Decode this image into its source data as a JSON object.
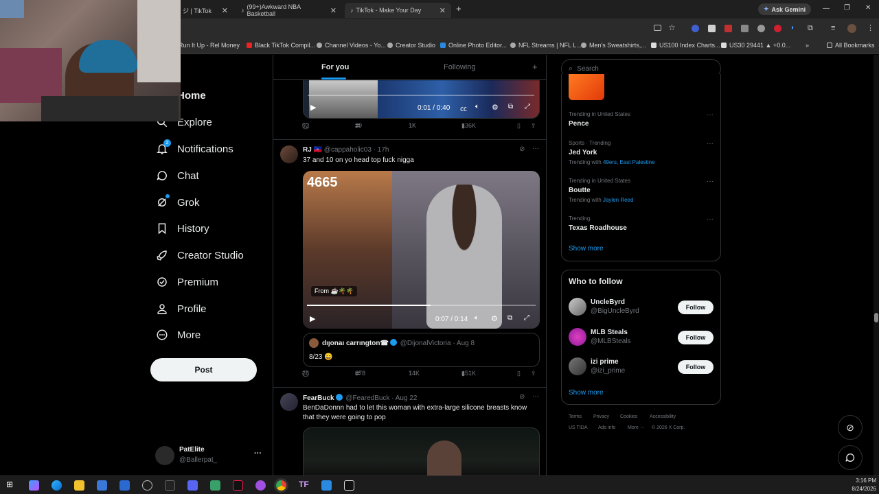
{
  "browser": {
    "tabs": [
      {
        "title": "ジ | TikTok"
      },
      {
        "title": "(99+)Awkward NBA Basketball"
      },
      {
        "title": "TikTok - Make Your Day"
      }
    ],
    "new_tab": "+",
    "ask_gemini": "Ask Gemini",
    "bookmarks": [
      "Run It Up - Rel Money",
      "Black TikTok Compil...",
      "Channel Videos - Yo...",
      "Creator Studio",
      "Online Photo Editor...",
      "NFL Streams | NFL L...",
      "Men's Sweatshirts,...",
      "US100 Index Charts...",
      "US30 29441 ▲ +0.0...",
      "All Bookmarks"
    ]
  },
  "nav": {
    "items": [
      {
        "label": "Home",
        "icon": "home-icon"
      },
      {
        "label": "Explore",
        "icon": "search-icon"
      },
      {
        "label": "Notifications",
        "icon": "bell-icon",
        "badge": "2"
      },
      {
        "label": "Chat",
        "icon": "chat-icon"
      },
      {
        "label": "Grok",
        "icon": "grok-icon"
      },
      {
        "label": "History",
        "icon": "bookmark-icon"
      },
      {
        "label": "Creator Studio",
        "icon": "rocket-icon"
      },
      {
        "label": "Premium",
        "icon": "verified-icon"
      },
      {
        "label": "Profile",
        "icon": "person-icon"
      },
      {
        "label": "More",
        "icon": "more-circle-icon"
      }
    ],
    "post_label": "Post",
    "account": {
      "name": "PatElite",
      "handle": "@Ballerpat_",
      "more": "···"
    }
  },
  "feed": {
    "tabs": {
      "for_you": "For you",
      "following": "Following"
    },
    "add": "+",
    "post0": {
      "video_time": "0:01 / 0:40",
      "replies": "92",
      "reposts": "29",
      "likes": "1K",
      "views": "136K"
    },
    "post1": {
      "author": "RJ 🇭🇹",
      "handle": "@cappaholic03 · 17h",
      "text": "37 and 10 on yo head top fuck nigga",
      "video_overlay_number": "4665",
      "from_label": "From ☕🌴🌴",
      "video_time": "0:07 / 0:14",
      "progress": 0.54,
      "quote": {
        "author": "dıȷonaı carrıngton☎",
        "handle": "@DijonalVictoria · Aug 8",
        "text": "8/23 😄"
      },
      "replies": "26",
      "reposts": "878",
      "likes": "14K",
      "views": "451K"
    },
    "post2": {
      "author": "FearBuck",
      "handle": "@FearedBuck · Aug 22",
      "text": "BenDaDonnn had to let this woman with extra-large silicone breasts know that they were going to pop"
    }
  },
  "sidebar": {
    "search_placeholder": "Search",
    "trends": [
      {
        "caption": "Trending in United States",
        "name": "Pence",
        "sub": "",
        "sub_link": ""
      },
      {
        "caption": "Sports · Trending",
        "name": "Jed York",
        "sub": "Trending with",
        "sub_link": "49ers, East Palestine"
      },
      {
        "caption": "Trending in United States",
        "name": "Boutte",
        "sub": "Trending with",
        "sub_link": "Jaylen Reed"
      },
      {
        "caption": "Trending",
        "name": "Texas Roadhouse",
        "sub": "",
        "sub_link": ""
      }
    ],
    "show_more": "Show more",
    "who_to_follow_title": "Who to follow",
    "follow_label": "Follow",
    "who_to_follow": [
      {
        "name": "UncleByrd",
        "handle": "@BigUncleByrd"
      },
      {
        "name": "MLB Steals",
        "handle": "@MLBSteals"
      },
      {
        "name": "izi prime",
        "handle": "@izi_prime"
      }
    ],
    "show_more_2": "Show more",
    "footer": [
      "Terms",
      "Privacy",
      "Cookies",
      "Accessibility",
      "US TIDA",
      "Ads info",
      "More ···",
      "© 2026 X Corp."
    ]
  },
  "taskbar": {
    "time": "3:16 PM",
    "date": "8/24/2026"
  },
  "colors": {
    "accent": "#1d9bf0",
    "background": "#000000",
    "border": "#2f3336"
  }
}
